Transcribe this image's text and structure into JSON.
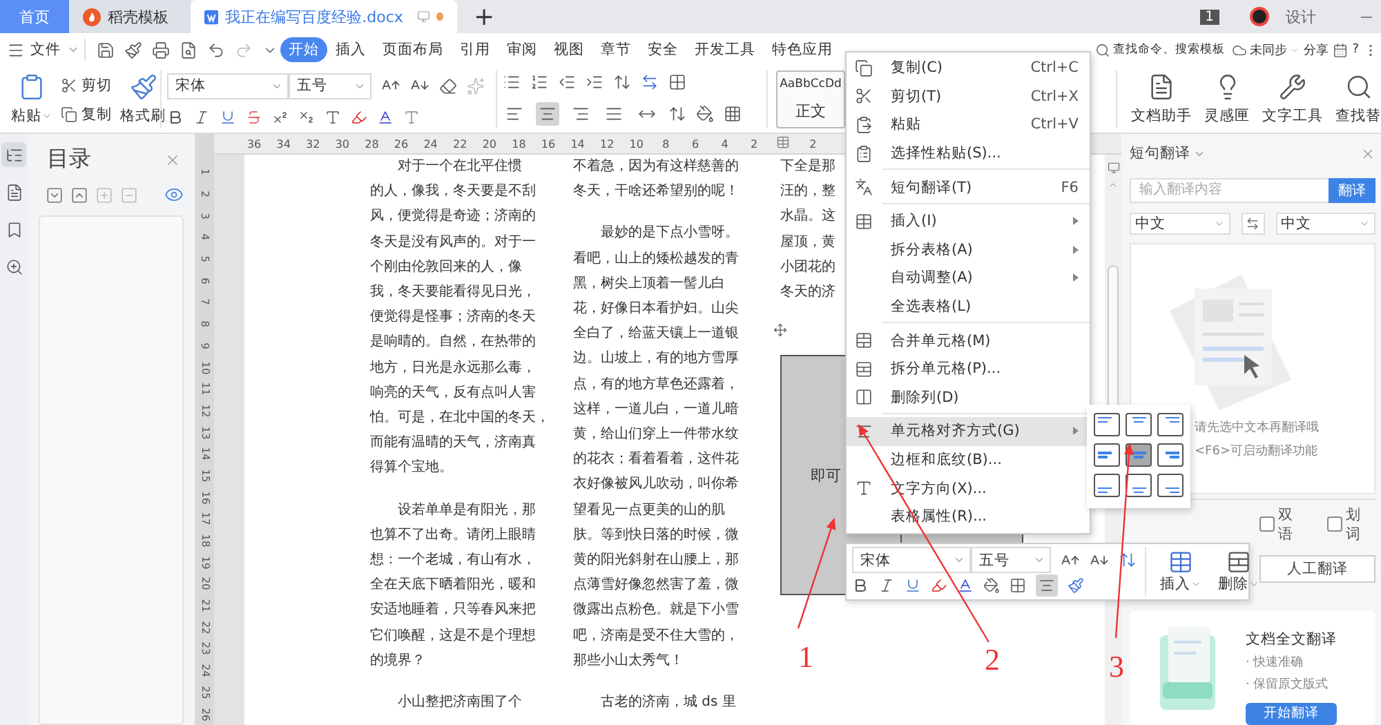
{
  "tabs": [
    {
      "label": "首页",
      "kind": "home",
      "selected": false
    },
    {
      "label": "稻壳模板",
      "kind": "docer",
      "selected": false
    },
    {
      "label": "我正在编写百度经验.docx",
      "kind": "doc",
      "selected": true
    }
  ],
  "new_tab": "+",
  "account": {
    "badge": "1",
    "name": "设计"
  },
  "menu": {
    "file": "文件",
    "tabs": [
      {
        "label": "开始",
        "selected": true
      },
      {
        "label": "插入",
        "selected": false
      },
      {
        "label": "页面布局",
        "selected": false
      },
      {
        "label": "引用",
        "selected": false
      },
      {
        "label": "审阅",
        "selected": false
      },
      {
        "label": "视图",
        "selected": false
      },
      {
        "label": "章节",
        "selected": false
      },
      {
        "label": "安全",
        "selected": false
      },
      {
        "label": "开发工具",
        "selected": false
      },
      {
        "label": "特色应用",
        "selected": false
      }
    ],
    "search": "查找命令、搜索模板",
    "sync": "未同步",
    "share": "分享",
    "help": "?"
  },
  "ribbon": {
    "paste": "粘贴",
    "cut": "剪切",
    "copy": "复制",
    "format_painter": "格式刷",
    "font": "宋体",
    "size": "五号",
    "alignment": [
      {
        "selected": false
      },
      {
        "selected": true
      },
      {
        "selected": false
      },
      {
        "selected": false
      },
      {
        "selected": false
      }
    ],
    "style_preview": "AaBbCcDd",
    "style_name": "正文",
    "tools": [
      "文档助手",
      "灵感匣",
      "文字工具",
      "查找替"
    ]
  },
  "sidebar": {
    "tabs": [
      {
        "selected": true
      },
      {
        "selected": false
      },
      {
        "selected": false
      },
      {
        "selected": false
      }
    ]
  },
  "outline": {
    "title": "目录"
  },
  "ruler": {
    "left_ticks": [
      "36",
      "34",
      "32",
      "30",
      "28",
      "26",
      "24",
      "22",
      "20",
      "18",
      "16",
      "14",
      "12",
      "10",
      "8",
      "6",
      "4",
      "2"
    ],
    "right_ticks": [
      "2"
    ],
    "side_ticks": [
      "1",
      "2",
      "3",
      "4",
      "5",
      "6",
      "7",
      "8",
      "9",
      "10",
      "11",
      "12",
      "13",
      "14",
      "15",
      "16",
      "17",
      "18",
      "19",
      "20",
      "21",
      "22",
      "23",
      "24",
      "25",
      "26"
    ]
  },
  "document": {
    "columns": [
      {
        "paragraphs": [
          {
            "indent": true,
            "lines": [
              "对于一个在北平住惯",
              "的人，像我，冬天要是不刮",
              "风，便觉得是奇迹；济南的",
              "冬天是没有风声的。对于一",
              "个刚由伦敦回来的人，像",
              "我，冬天要能看得见日光，",
              "便觉得是怪事；济南的冬天",
              "是响晴的。自然，在热带的",
              "地方，日光是永远那么毒，",
              "响亮的天气，反有点叫人害",
              "怕。可是，在北中国的冬天，",
              "而能有温晴的天气，济南真",
              "得算个宝地。"
            ]
          },
          {
            "indent": true,
            "lines": [
              "设若单单是有阳光，那",
              "也算不了出奇。请闭上眼睛",
              "想：一个老城，有山有水，",
              "全在天底下晒着阳光，暖和",
              "安适地睡着，只等春风来把",
              "它们唤醒，这是不是个理想",
              "的境界？"
            ]
          },
          {
            "indent": true,
            "lines": [
              "小山整把济南围了个"
            ]
          }
        ]
      },
      {
        "paragraphs": [
          {
            "indent": false,
            "lines": [
              "不着急，因为有这样慈善的",
              "冬天，干啥还希望别的呢！"
            ]
          },
          {
            "indent": true,
            "lines": [
              "最妙的是下点小雪呀。",
              "看吧，山上的矮松越发的青",
              "黑，树尖上顶着一髻儿白",
              "花，好像日本看护妇。山尖",
              "全白了，给蓝天镶上一道银",
              "边。山坡上，有的地方雪厚",
              "点，有的地方草色还露着，",
              "这样，一道儿白，一道儿暗",
              "黄，给山们穿上一件带水纹",
              "的花衣；看着看着，这件花",
              "衣好像被风儿吹动，叫你希",
              "望看见一点更美的山的肌",
              "肤。等到快日落的时候，微",
              "黄的阳光斜射在山腰上，那",
              "点薄雪好像忽然害了羞，微",
              "微露出点粉色。就是下小雪",
              "吧，济南是受不住大雪的，",
              "那些小山太秀气！"
            ]
          },
          {
            "indent": true,
            "lines": [
              "古老的济南，城 ds 里"
            ]
          }
        ]
      },
      {
        "paragraphs": [
          {
            "indent": false,
            "lines": [
              "下全是那",
              "汪的，整",
              "水晶。这",
              "屋顶，黄",
              "小团花的",
              "冬天的济"
            ]
          }
        ]
      }
    ],
    "table_cells": [
      "即可",
      ""
    ]
  },
  "context_menu": [
    {
      "kind": "item",
      "label": "复制(C)",
      "shortcut": "Ctrl+C",
      "submenu": false,
      "selected": false
    },
    {
      "kind": "item",
      "label": "剪切(T)",
      "shortcut": "Ctrl+X",
      "submenu": false,
      "selected": false
    },
    {
      "kind": "item",
      "label": "粘贴",
      "shortcut": "Ctrl+V",
      "submenu": false,
      "selected": false
    },
    {
      "kind": "item",
      "label": "选择性粘贴(S)...",
      "submenu": false,
      "selected": false
    },
    {
      "kind": "separator"
    },
    {
      "kind": "item",
      "label": "短句翻译(T)",
      "shortcut": "F6",
      "submenu": false,
      "selected": false
    },
    {
      "kind": "separator"
    },
    {
      "kind": "item",
      "label": "插入(I)",
      "submenu": true,
      "selected": false
    },
    {
      "kind": "item",
      "label": "拆分表格(A)",
      "submenu": true,
      "selected": false
    },
    {
      "kind": "item",
      "label": "自动调整(A)",
      "submenu": true,
      "selected": false
    },
    {
      "kind": "item",
      "label": "全选表格(L)",
      "submenu": false,
      "selected": false
    },
    {
      "kind": "separator"
    },
    {
      "kind": "item",
      "label": "合并单元格(M)",
      "submenu": false,
      "selected": false
    },
    {
      "kind": "item",
      "label": "拆分单元格(P)...",
      "submenu": false,
      "selected": false
    },
    {
      "kind": "item",
      "label": "删除列(D)",
      "submenu": false,
      "selected": false
    },
    {
      "kind": "separator"
    },
    {
      "kind": "item",
      "label": "单元格对齐方式(G)",
      "submenu": true,
      "selected": true
    },
    {
      "kind": "item",
      "label": "边框和底纹(B)...",
      "submenu": false,
      "selected": false
    },
    {
      "kind": "item",
      "label": "文字方向(X)...",
      "submenu": false,
      "selected": false
    },
    {
      "kind": "item",
      "label": "表格属性(R)...",
      "submenu": false,
      "selected": false
    }
  ],
  "align_options": [
    {
      "selected": false
    },
    {
      "selected": false
    },
    {
      "selected": false
    },
    {
      "selected": false
    },
    {
      "selected": true
    },
    {
      "selected": false
    },
    {
      "selected": false
    },
    {
      "selected": false
    },
    {
      "selected": false
    }
  ],
  "mini_toolbar": {
    "font": "宋体",
    "size": "五号",
    "insert": "插入",
    "delete": "删除",
    "align_selected": true
  },
  "translate_panel": {
    "title": "短句翻译",
    "placeholder": "输入翻译内容",
    "translate": "翻译",
    "source": "中文",
    "target": "中文",
    "hint": [
      "请先选中文本再翻译哦",
      "<F6>可启动翻译功能"
    ],
    "options": [
      {
        "label": "双语",
        "checked": false
      },
      {
        "label": "划词",
        "checked": false
      }
    ],
    "human": "人工翻译",
    "promo": {
      "title": "文档全文翻译",
      "points": [
        "· 快速准确",
        "· 保留原文版式"
      ],
      "button": "开始翻译"
    }
  },
  "annotations": [
    "1",
    "2",
    "3"
  ]
}
